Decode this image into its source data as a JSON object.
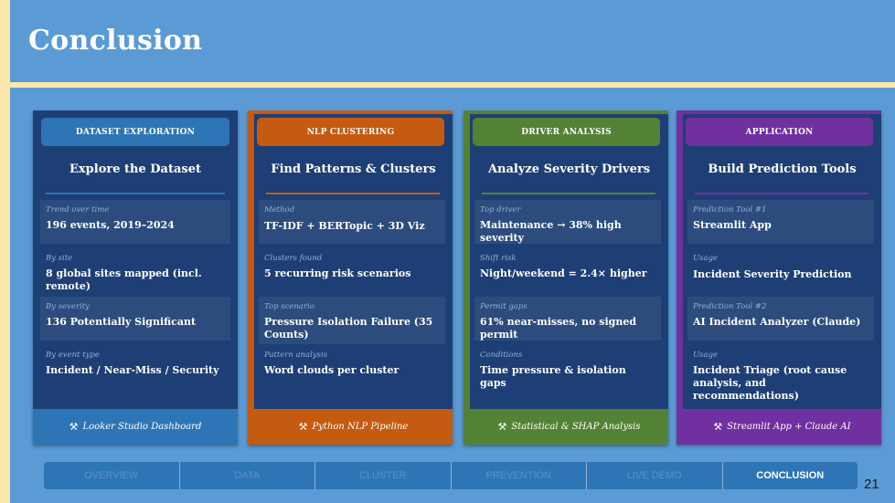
{
  "page": {
    "title": "Conclusion",
    "slide_number": "21"
  },
  "cards": [
    {
      "tag": "DATASET EXPLORATION",
      "heading": "Explore the Dataset",
      "items": [
        {
          "label": "Trend over time",
          "value": "196 events, 2019–2024"
        },
        {
          "label": "By site",
          "value": "8 global sites mapped (incl. remote)"
        },
        {
          "label": "By severity",
          "value": "136 Potentially Significant"
        },
        {
          "label": "By event type",
          "value": "Incident / Near-Miss / Security"
        }
      ],
      "footer": "Looker Studio Dashboard",
      "footer_icon": "hammer-wrench-icon"
    },
    {
      "tag": "NLP CLUSTERING",
      "heading": "Find Patterns & Clusters",
      "items": [
        {
          "label": "Method",
          "value": "TF-IDF + BERTopic + 3D Viz"
        },
        {
          "label": "Clusters found",
          "value": "5 recurring risk scenarios"
        },
        {
          "label": "Top scenario",
          "value": "Pressure Isolation Failure (35 Counts)"
        },
        {
          "label": "Pattern analysis",
          "value": "Word clouds per cluster"
        }
      ],
      "footer": "Python NLP Pipeline",
      "footer_icon": "hammer-wrench-icon"
    },
    {
      "tag": "DRIVER ANALYSIS",
      "heading": "Analyze Severity Drivers",
      "items": [
        {
          "label": "Top driver",
          "value": "Maintenance → 38% high severity"
        },
        {
          "label": "Shift risk",
          "value": "Night/weekend = 2.4× higher"
        },
        {
          "label": "Permit gaps",
          "value": "61% near-misses, no signed permit"
        },
        {
          "label": "Conditions",
          "value": "Time pressure & isolation gaps"
        }
      ],
      "footer": "Statistical & SHAP Analysis",
      "footer_icon": "hammer-wrench-icon"
    },
    {
      "tag": "APPLICATION",
      "heading": "Build Prediction Tools",
      "items": [
        {
          "label": "Prediction Tool #1",
          "value": "Streamlit App"
        },
        {
          "label": "Usage",
          "value": "Incident Severity Prediction"
        },
        {
          "label": "Prediction Tool #2",
          "value": "AI Incident Analyzer (Claude)"
        },
        {
          "label": "Usage",
          "value": "Incident Triage (root cause analysis, and recommendations)"
        }
      ],
      "footer": "Streamlit App + Claude AI",
      "footer_icon": "hammer-wrench-icon"
    }
  ],
  "colors": {
    "background": "#5b9bd5",
    "accent_cream": "#fbe9ac",
    "card_body": "#1e3f75",
    "exploration": "#2e75b6",
    "clustering": "#c55a11",
    "drivers": "#548235",
    "application": "#7030a0"
  },
  "nav": {
    "tabs": [
      "OVERVIEW",
      "DATA",
      "CLUSTER",
      "PREVENTION",
      "LIVE DEMO",
      "CONCLUSION"
    ],
    "active": "CONCLUSION"
  }
}
